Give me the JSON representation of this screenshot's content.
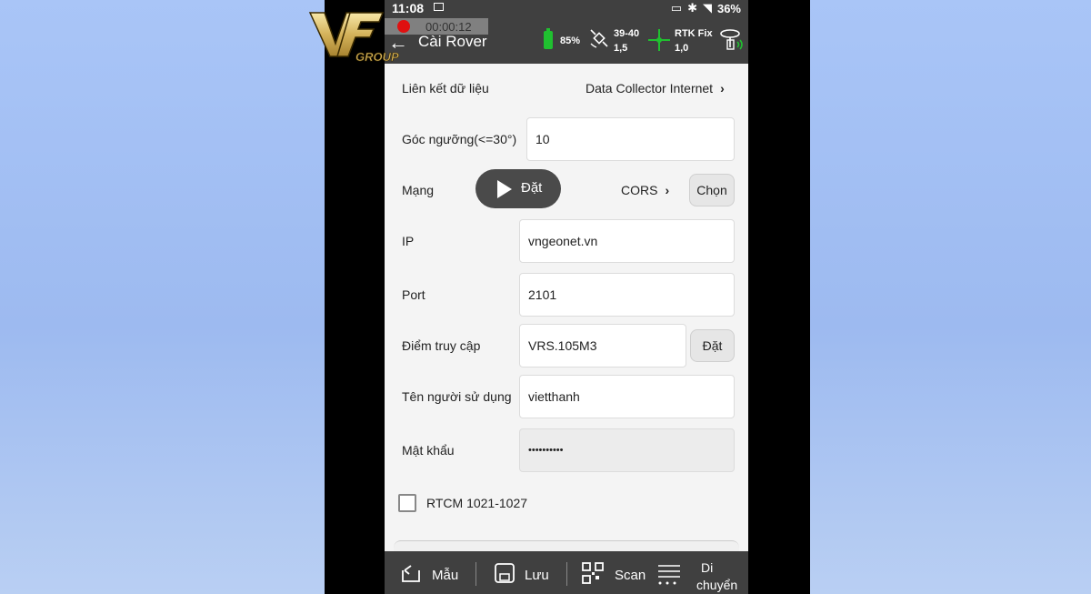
{
  "status": {
    "time": "11:08",
    "battery": "36%"
  },
  "recording": {
    "time": "00:00:12"
  },
  "header": {
    "title": "Cài Rover",
    "battery_pct": "85%",
    "sat_count": "39-40",
    "sat_value": "1,5",
    "rtk_status": "RTK Fix",
    "rtk_value": "1,0"
  },
  "logo": {
    "text": "VF",
    "sub": "GROUP"
  },
  "form": {
    "data_link": {
      "label": "Liên kết dữ liệu",
      "value": "Data Collector Internet"
    },
    "cutoff": {
      "label": "Góc ngưỡng(<=30°)",
      "value": "10"
    },
    "network": {
      "label": "Mạng",
      "overlay": "Đặt",
      "value": "CORS",
      "button": "Chọn"
    },
    "ip": {
      "label": "IP",
      "value": "vngeonet.vn"
    },
    "port": {
      "label": "Port",
      "value": "2101"
    },
    "mountpoint": {
      "label": "Điểm truy cập",
      "value": "VRS.105M3",
      "button": "Đặt"
    },
    "username": {
      "label": "Tên người sử dụng",
      "value": "vietthanh"
    },
    "password": {
      "label": "Mật khẩu",
      "value": "••••••••••"
    },
    "rtcm": {
      "label": "RTCM 1021-1027",
      "checked": false
    }
  },
  "bottombar": {
    "template": "Mẫu",
    "save": "Lưu",
    "scan": "Scan",
    "move_line1": "Di",
    "move_line2": "chuyển"
  },
  "colors": {
    "bar": "#404040",
    "background": "#f4f4f4",
    "fix": "#20c030",
    "record": "#e01010"
  }
}
